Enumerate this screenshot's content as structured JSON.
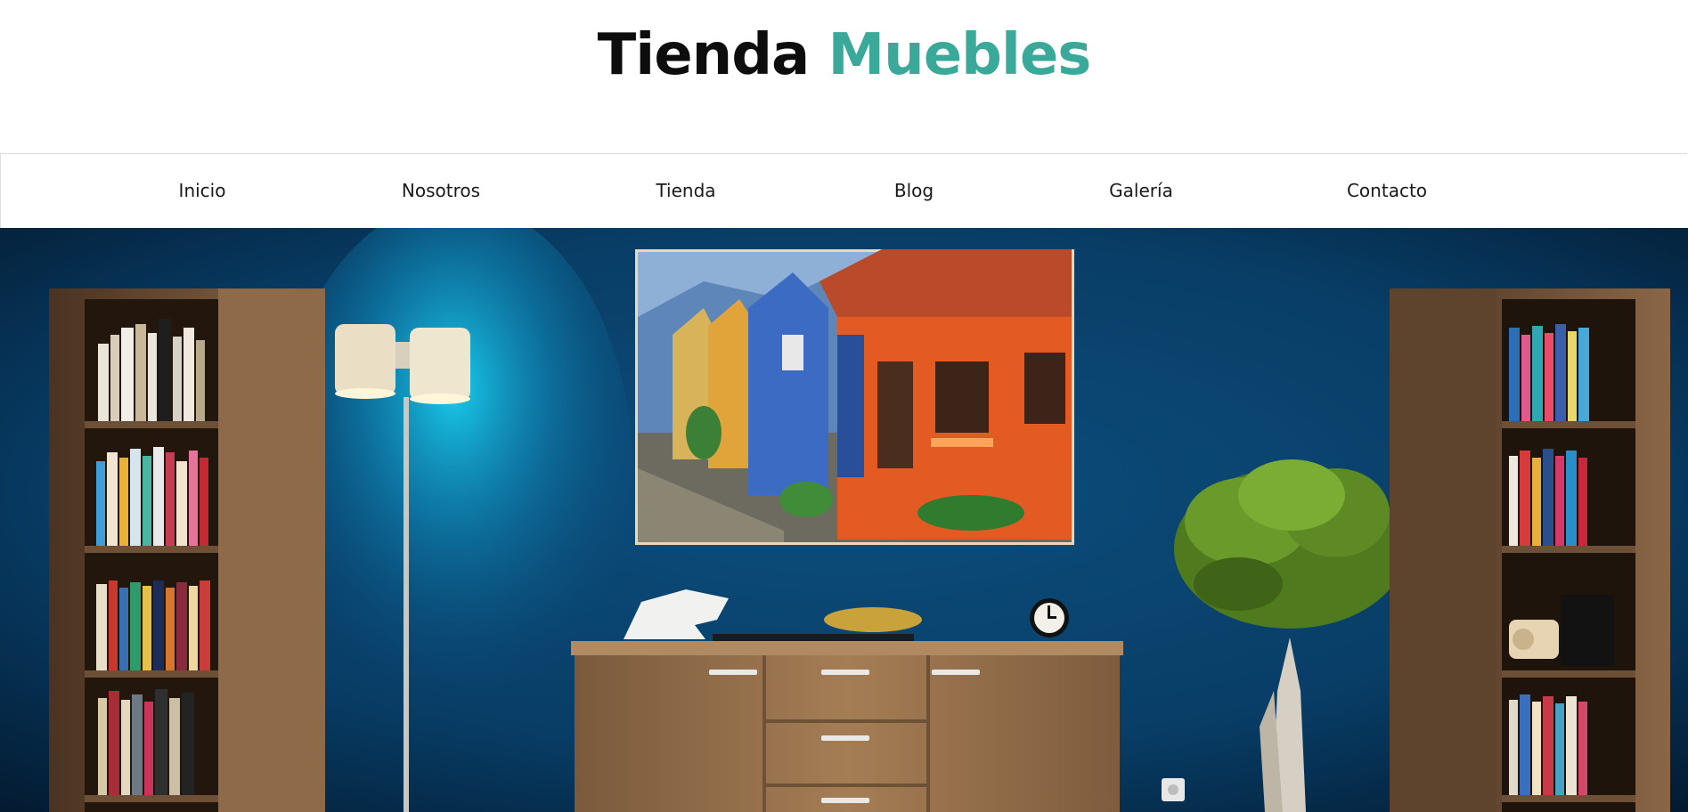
{
  "brand": {
    "word1": "Tienda",
    "word2": "Muebles",
    "accent_color": "#3aa99a"
  },
  "nav": {
    "items": [
      {
        "label": "Inicio"
      },
      {
        "label": "Nosotros"
      },
      {
        "label": "Tienda"
      },
      {
        "label": "Blog"
      },
      {
        "label": "Galería"
      },
      {
        "label": "Contacto"
      }
    ]
  },
  "hero": {
    "icon": "living-room-photo",
    "colors": {
      "wall": "#0a4a78",
      "wood": "#9a744f",
      "lamp_glow": "#19c4e8"
    }
  }
}
